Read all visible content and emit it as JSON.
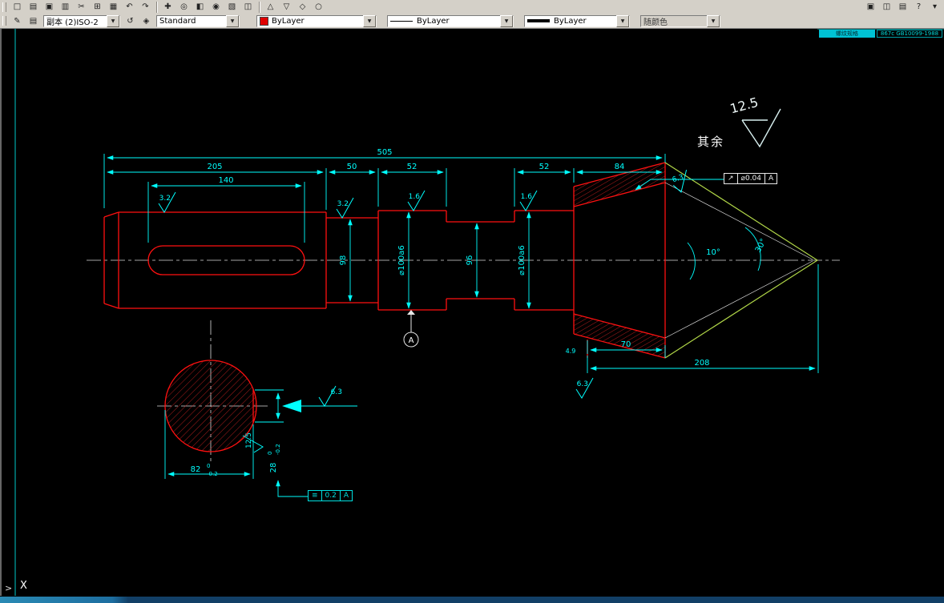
{
  "toolbar": {
    "arrow": "▼",
    "row1a": [
      "□",
      "▤",
      "▣",
      "▥",
      "✂",
      "⊞",
      "▦",
      "↶",
      "↷"
    ],
    "row1b": [
      "✚",
      "◎",
      "◧",
      "◉",
      "▧",
      "◫"
    ],
    "row1c": [
      "△",
      "▽",
      "◇",
      "○"
    ],
    "row1r": [
      "▣",
      "◫",
      "▤",
      "?",
      "▾"
    ],
    "pencil": "✎",
    "layers": "▤",
    "layer_prev": "↺",
    "layer_states": "◈",
    "layer_value": "副本 (2)ISO-2",
    "style_value": "Standard",
    "color_value": "ByLayer",
    "linetype_value": "ByLayer",
    "lineweight_value": "ByLayer",
    "plotstyle_value": "随颜色"
  },
  "dims": {
    "total": "505",
    "len1": "205",
    "key_len": "140",
    "len2": "50",
    "len3": "52",
    "len4": "52",
    "len5": "84",
    "cone_len": "70",
    "tip_len": "208",
    "dia1": "98",
    "dia2": "⌀100a6",
    "dia3": "96",
    "dia4": "⌀100a6",
    "angle1": "10°",
    "angle2": "30°",
    "sec_dia": "82",
    "sec_tol_hi": "0",
    "sec_tol_lo": "-0.2",
    "key_w": "28",
    "key_w_hi": "0",
    "key_w_lo": "-0.2",
    "note_small": "4.9"
  },
  "rough": {
    "r1": "3.2",
    "r2": "3.2",
    "r3": "1.6",
    "r4": "1.6",
    "r5": "6.3",
    "r6": "6.3",
    "r7": "6.3",
    "r8": "12.5",
    "general": "12.5",
    "general_label": "其余"
  },
  "fcf1": {
    "sym": "↗",
    "val": "⌀0.04",
    "datum": "A"
  },
  "fcf2": {
    "sym": "≡",
    "val": "0.2",
    "datum": "A"
  },
  "datum_label": "A",
  "corner": {
    "c1": "螺纹规格",
    "c2": "867c GB10099-1988"
  },
  "command": {
    "prompt": ">",
    "axis": "X"
  }
}
